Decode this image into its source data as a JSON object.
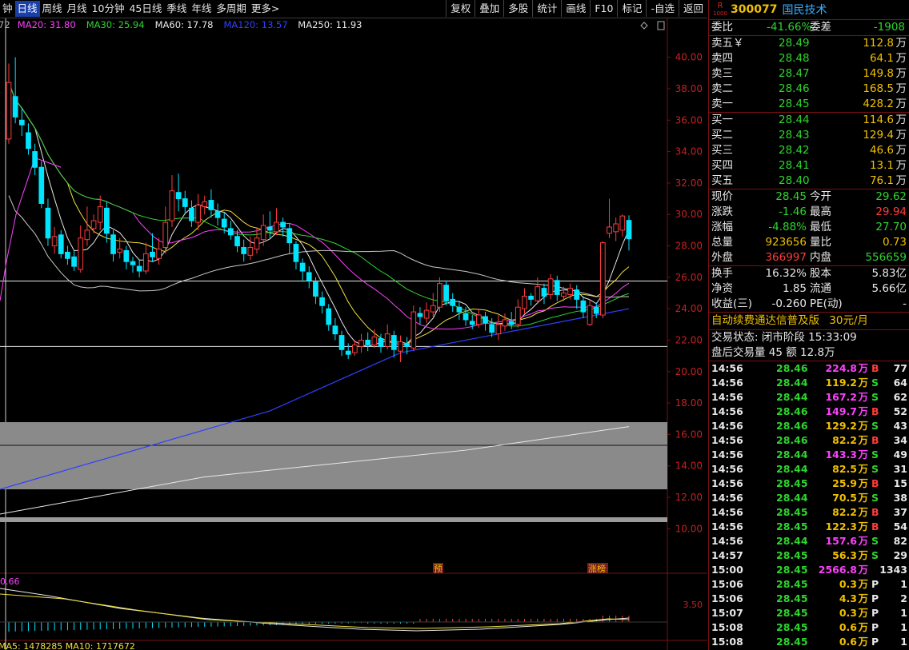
{
  "toolbar": {
    "periods": [
      "钟",
      "日线",
      "周线",
      "月线",
      "10分钟",
      "45日线",
      "季线",
      "年线",
      "多周期",
      "更多>"
    ],
    "active_index": 1,
    "tools": [
      "复权",
      "叠加",
      "多股",
      "统计",
      "画线",
      "F10",
      "标记",
      "-自选",
      "返回"
    ]
  },
  "chart": {
    "ma_legend": [
      {
        "label": "72",
        "color": "#b0b0b0"
      },
      {
        "label": "MA20: 31.80",
        "color": "#ff40ff"
      },
      {
        "label": "MA30: 25.94",
        "color": "#2dd52d"
      },
      {
        "label": "MA60: 17.78",
        "color": "#e8e8e8"
      },
      {
        "label": "MA120: 13.57",
        "color": "#3040ff"
      },
      {
        "label": "MA250: 11.93",
        "color": "#e8e8e8"
      }
    ],
    "price_axis": [
      "40.00",
      "38.00",
      "36.00",
      "34.00",
      "32.00",
      "30.00",
      "28.00",
      "26.00",
      "24.00",
      "22.00",
      "20.00",
      "18.00",
      "16.00",
      "14.00",
      "12.00",
      "10.00"
    ],
    "markers": {
      "pre": "预",
      "zhangbang": "涨榜"
    },
    "macd_left_label": "0.66",
    "macd_right_label": "3.50",
    "vol_legend": "MA5: 1478285  MA10: 1717672",
    "colors": {
      "up": "#ff3c3c",
      "down": "#00e5ff",
      "bg": "#000000"
    }
  },
  "quote": {
    "r_badge": "R",
    "r_badge_sub": "1000",
    "code": "300077",
    "name": "国民技术",
    "weibi_label": "委比",
    "weibi_value": "-41.66%",
    "weicha_label": "委差",
    "weicha_value": "-1908",
    "asks": [
      {
        "label": "卖五￥",
        "price": "28.49",
        "vol": "112.8",
        "unit": "万"
      },
      {
        "label": "卖四",
        "price": "28.48",
        "vol": "64.1",
        "unit": "万"
      },
      {
        "label": "卖三",
        "price": "28.47",
        "vol": "149.8",
        "unit": "万"
      },
      {
        "label": "卖二",
        "price": "28.46",
        "vol": "168.5",
        "unit": "万"
      },
      {
        "label": "卖一",
        "price": "28.45",
        "vol": "428.2",
        "unit": "万"
      }
    ],
    "bids": [
      {
        "label": "买一",
        "price": "28.44",
        "vol": "114.6",
        "unit": "万"
      },
      {
        "label": "买二",
        "price": "28.43",
        "vol": "129.4",
        "unit": "万"
      },
      {
        "label": "买三",
        "price": "28.42",
        "vol": "46.6",
        "unit": "万"
      },
      {
        "label": "买四",
        "price": "28.41",
        "vol": "13.1",
        "unit": "万"
      },
      {
        "label": "买五",
        "price": "28.40",
        "vol": "76.1",
        "unit": "万"
      }
    ],
    "stats": [
      {
        "l1": "现价",
        "v1": "28.45",
        "c1": "g",
        "l2": "今开",
        "v2": "29.62",
        "c2": "g"
      },
      {
        "l1": "涨跌",
        "v1": "-1.46",
        "c1": "g",
        "l2": "最高",
        "v2": "29.94",
        "c2": "r"
      },
      {
        "l1": "涨幅",
        "v1": "-4.88%",
        "c1": "g",
        "l2": "最低",
        "v2": "27.70",
        "c2": "g"
      },
      {
        "l1": "总量",
        "v1": "923656",
        "c1": "y",
        "l2": "量比",
        "v2": "0.73",
        "c2": "y"
      },
      {
        "l1": "外盘",
        "v1": "366997",
        "c1": "r",
        "l2": "内盘",
        "v2": "556659",
        "c2": "g"
      }
    ],
    "stats2": [
      {
        "l1": "换手",
        "v1": "16.32%",
        "l2": "股本",
        "v2": "5.83亿"
      },
      {
        "l1": "净资",
        "v1": "1.85",
        "l2": "流通",
        "v2": "5.66亿"
      },
      {
        "l1": "收益(三)",
        "v1": "-0.260",
        "l2": "PE(动)",
        "v2": "-"
      }
    ],
    "promo_text": "自动续费通达信普及版",
    "promo_price": "30元/月",
    "trade_status": "交易状态: 闭市阶段 15:33:09",
    "after_hours": "盘后交易量 45 额 12.8万"
  },
  "ticks": [
    {
      "t": "14:56",
      "p": "28.46",
      "v": "224.8",
      "u": "万",
      "vc": "m",
      "s": "B",
      "n": "77"
    },
    {
      "t": "14:56",
      "p": "28.44",
      "v": "119.2",
      "u": "万",
      "vc": "y",
      "s": "S",
      "n": "64"
    },
    {
      "t": "14:56",
      "p": "28.44",
      "v": "167.2",
      "u": "万",
      "vc": "m",
      "s": "S",
      "n": "62"
    },
    {
      "t": "14:56",
      "p": "28.46",
      "v": "149.7",
      "u": "万",
      "vc": "m",
      "s": "B",
      "n": "52"
    },
    {
      "t": "14:56",
      "p": "28.46",
      "v": "129.2",
      "u": "万",
      "vc": "y",
      "s": "S",
      "n": "43"
    },
    {
      "t": "14:56",
      "p": "28.46",
      "v": "82.2",
      "u": "万",
      "vc": "y",
      "s": "B",
      "n": "34"
    },
    {
      "t": "14:56",
      "p": "28.44",
      "v": "143.3",
      "u": "万",
      "vc": "m",
      "s": "S",
      "n": "49"
    },
    {
      "t": "14:56",
      "p": "28.44",
      "v": "82.5",
      "u": "万",
      "vc": "y",
      "s": "S",
      "n": "31"
    },
    {
      "t": "14:56",
      "p": "28.45",
      "v": "25.9",
      "u": "万",
      "vc": "y",
      "s": "B",
      "n": "15"
    },
    {
      "t": "14:56",
      "p": "28.44",
      "v": "70.5",
      "u": "万",
      "vc": "y",
      "s": "S",
      "n": "38"
    },
    {
      "t": "14:56",
      "p": "28.45",
      "v": "82.2",
      "u": "万",
      "vc": "y",
      "s": "B",
      "n": "37"
    },
    {
      "t": "14:56",
      "p": "28.45",
      "v": "122.3",
      "u": "万",
      "vc": "y",
      "s": "B",
      "n": "54"
    },
    {
      "t": "14:56",
      "p": "28.44",
      "v": "157.6",
      "u": "万",
      "vc": "m",
      "s": "S",
      "n": "82"
    },
    {
      "t": "14:57",
      "p": "28.45",
      "v": "56.3",
      "u": "万",
      "vc": "y",
      "s": "S",
      "n": "29"
    },
    {
      "t": "15:00",
      "p": "28.45",
      "v": "2566.8",
      "u": "万",
      "vc": "m",
      "s": "",
      "n": "1343"
    },
    {
      "t": "15:06",
      "p": "28.45",
      "v": "0.3",
      "u": "万",
      "vc": "y",
      "s": "P",
      "n": "1"
    },
    {
      "t": "15:06",
      "p": "28.45",
      "v": "4.3",
      "u": "万",
      "vc": "y",
      "s": "P",
      "n": "2"
    },
    {
      "t": "15:07",
      "p": "28.45",
      "v": "0.3",
      "u": "万",
      "vc": "y",
      "s": "P",
      "n": "1"
    },
    {
      "t": "15:08",
      "p": "28.45",
      "v": "0.6",
      "u": "万",
      "vc": "y",
      "s": "P",
      "n": "1"
    },
    {
      "t": "15:08",
      "p": "28.45",
      "v": "0.6",
      "u": "万",
      "vc": "y",
      "s": "P",
      "n": "1"
    }
  ],
  "chart_data": {
    "type": "candlestick",
    "y_axis_range": [
      9,
      41
    ],
    "horizontal_levels": [
      25.76,
      21.6
    ],
    "candles": [
      [
        34.8,
        38.4,
        39.6,
        34.5
      ],
      [
        37.5,
        36.2,
        40.0,
        35.8
      ],
      [
        36.0,
        35.7,
        36.8,
        35.0
      ],
      [
        35.2,
        34.2,
        35.8,
        33.8
      ],
      [
        34.0,
        33.0,
        34.5,
        32.5
      ],
      [
        33.0,
        30.7,
        33.4,
        30.4
      ],
      [
        30.4,
        28.5,
        31.0,
        28.0
      ],
      [
        28.0,
        28.6,
        29.2,
        27.5
      ],
      [
        28.7,
        27.5,
        29.0,
        27.2
      ],
      [
        27.6,
        27.2,
        28.0,
        26.8
      ],
      [
        27.3,
        26.7,
        27.7,
        26.4
      ],
      [
        26.5,
        28.5,
        29.3,
        26.3
      ],
      [
        28.4,
        29.0,
        30.5,
        28.0
      ],
      [
        29.1,
        29.6,
        30.0,
        28.8
      ],
      [
        29.5,
        30.5,
        31.2,
        29.0
      ],
      [
        30.4,
        28.8,
        30.8,
        28.2
      ],
      [
        28.7,
        27.5,
        29.0,
        27.0
      ],
      [
        27.6,
        27.8,
        28.5,
        27.2
      ],
      [
        27.7,
        27.0,
        28.0,
        26.5
      ],
      [
        27.0,
        26.8,
        27.3,
        26.3
      ],
      [
        26.7,
        26.4,
        27.1,
        26.0
      ],
      [
        26.4,
        27.5,
        28.2,
        26.2
      ],
      [
        27.6,
        27.3,
        28.8,
        27.0
      ],
      [
        27.2,
        27.8,
        28.5,
        26.8
      ],
      [
        27.9,
        29.5,
        30.5,
        27.5
      ],
      [
        29.6,
        31.5,
        32.5,
        29.2
      ],
      [
        31.4,
        31.0,
        32.6,
        30.2
      ],
      [
        31.0,
        30.5,
        31.5,
        30.0
      ],
      [
        30.4,
        29.6,
        30.9,
        29.2
      ],
      [
        29.5,
        30.6,
        31.3,
        29.0
      ],
      [
        30.5,
        30.8,
        31.2,
        30.0
      ],
      [
        30.9,
        30.3,
        31.6,
        29.8
      ],
      [
        30.2,
        29.8,
        30.7,
        29.3
      ],
      [
        29.7,
        29.2,
        30.1,
        28.8
      ],
      [
        29.1,
        28.7,
        29.6,
        28.4
      ],
      [
        28.6,
        28.0,
        29.0,
        27.6
      ],
      [
        27.9,
        27.5,
        28.4,
        27.0
      ],
      [
        27.4,
        27.9,
        28.6,
        27.1
      ],
      [
        27.8,
        28.5,
        29.2,
        27.5
      ],
      [
        28.4,
        29.3,
        30.0,
        28.0
      ],
      [
        29.2,
        29.0,
        30.2,
        28.5
      ],
      [
        28.9,
        29.5,
        30.4,
        28.7
      ],
      [
        29.5,
        29.2,
        29.8,
        28.6
      ],
      [
        29.1,
        28.2,
        29.4,
        27.5
      ],
      [
        28.1,
        27.0,
        28.3,
        26.5
      ],
      [
        26.9,
        26.4,
        27.2,
        25.8
      ],
      [
        26.3,
        25.8,
        26.7,
        25.3
      ],
      [
        25.7,
        24.8,
        26.0,
        24.3
      ],
      [
        24.7,
        24.2,
        25.1,
        23.7
      ],
      [
        24.0,
        23.0,
        24.3,
        22.6
      ],
      [
        22.9,
        22.4,
        23.4,
        22.0
      ],
      [
        22.3,
        21.4,
        22.6,
        21.0
      ],
      [
        21.3,
        21.1,
        21.8,
        20.8
      ],
      [
        21.2,
        21.7,
        22.0,
        21.0
      ],
      [
        21.6,
        22.0,
        22.4,
        21.2
      ],
      [
        22.0,
        21.7,
        22.5,
        21.3
      ],
      [
        21.7,
        22.2,
        22.7,
        21.5
      ],
      [
        22.1,
        21.6,
        22.4,
        21.2
      ],
      [
        21.6,
        22.4,
        23.0,
        21.4
      ],
      [
        22.3,
        21.4,
        22.6,
        20.9
      ],
      [
        21.3,
        21.9,
        22.3,
        20.6
      ],
      [
        21.8,
        21.6,
        22.2,
        21.1
      ],
      [
        21.5,
        23.8,
        24.2,
        21.3
      ],
      [
        23.7,
        23.5,
        24.1,
        23.0
      ],
      [
        23.4,
        23.9,
        24.4,
        23.1
      ],
      [
        23.8,
        24.2,
        25.0,
        23.5
      ],
      [
        24.1,
        25.6,
        26.0,
        23.8
      ],
      [
        25.5,
        24.5,
        25.8,
        24.2
      ],
      [
        24.6,
        24.2,
        25.0,
        23.8
      ],
      [
        24.1,
        23.8,
        24.5,
        23.3
      ],
      [
        23.7,
        23.3,
        24.1,
        22.9
      ],
      [
        23.2,
        23.0,
        23.6,
        22.7
      ],
      [
        23.0,
        23.6,
        24.0,
        22.8
      ],
      [
        23.5,
        23.1,
        23.8,
        22.6
      ],
      [
        23.0,
        22.5,
        23.4,
        22.2
      ],
      [
        22.4,
        23.0,
        23.6,
        22.0
      ],
      [
        22.9,
        23.3,
        23.7,
        22.6
      ],
      [
        23.2,
        23.0,
        23.8,
        22.7
      ],
      [
        23.0,
        24.1,
        24.6,
        22.8
      ],
      [
        24.0,
        24.8,
        25.3,
        23.7
      ],
      [
        24.8,
        24.6,
        25.0,
        24.2
      ],
      [
        24.5,
        25.4,
        26.0,
        24.3
      ],
      [
        25.3,
        24.8,
        25.6,
        24.3
      ],
      [
        24.9,
        25.9,
        26.2,
        24.6
      ],
      [
        25.8,
        24.9,
        26.1,
        24.5
      ],
      [
        24.8,
        25.0,
        25.4,
        24.5
      ],
      [
        24.9,
        25.3,
        25.6,
        24.6
      ],
      [
        25.2,
        24.6,
        25.5,
        24.0
      ],
      [
        24.5,
        23.8,
        24.8,
        23.4
      ],
      [
        23.0,
        24.2,
        24.6,
        22.9
      ],
      [
        24.1,
        23.7,
        24.4,
        23.4
      ],
      [
        23.6,
        28.2,
        28.3,
        23.4
      ],
      [
        28.8,
        29.2,
        31.0,
        28.5
      ],
      [
        28.9,
        29.4,
        29.8,
        28.3
      ],
      [
        29.0,
        29.9,
        30.0,
        28.6
      ],
      [
        29.62,
        28.45,
        29.94,
        27.7
      ]
    ],
    "ma_series": [
      "MA5",
      "MA10",
      "MA20",
      "MA30",
      "MA60",
      "MA120"
    ],
    "ma_endpoints": {
      "MA5": 26.4,
      "MA10": 25.7,
      "MA20": 25.3,
      "MA30": 24.6,
      "MA60": 26.0,
      "MA120": 24.0,
      "MA250": 16.5
    }
  }
}
